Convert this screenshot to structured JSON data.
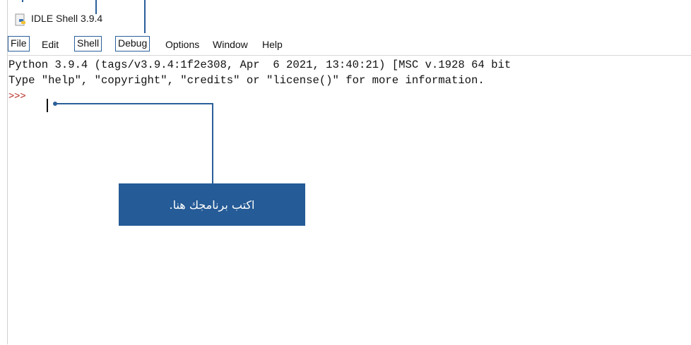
{
  "window": {
    "title": "IDLE Shell 3.9.4",
    "icon": "python-file-icon"
  },
  "menubar": {
    "items": [
      {
        "label": "File",
        "highlighted": true
      },
      {
        "label": "Edit",
        "highlighted": false
      },
      {
        "label": "Shell",
        "highlighted": true
      },
      {
        "label": "Debug",
        "highlighted": true
      },
      {
        "label": "Options",
        "highlighted": false
      },
      {
        "label": "Window",
        "highlighted": false
      },
      {
        "label": "Help",
        "highlighted": false
      }
    ]
  },
  "shell": {
    "lines": [
      "Python 3.9.4 (tags/v3.9.4:1f2e308, Apr  6 2021, 13:40:21) [MSC v.1928 64 bit",
      "Type \"help\", \"copyright\", \"credits\" or \"license()\" for more information."
    ],
    "prompt": ">>>",
    "prompt_color": "#b3261e"
  },
  "callout": {
    "text": "اكتب برنامجك هنا.",
    "color": "#255b96"
  }
}
